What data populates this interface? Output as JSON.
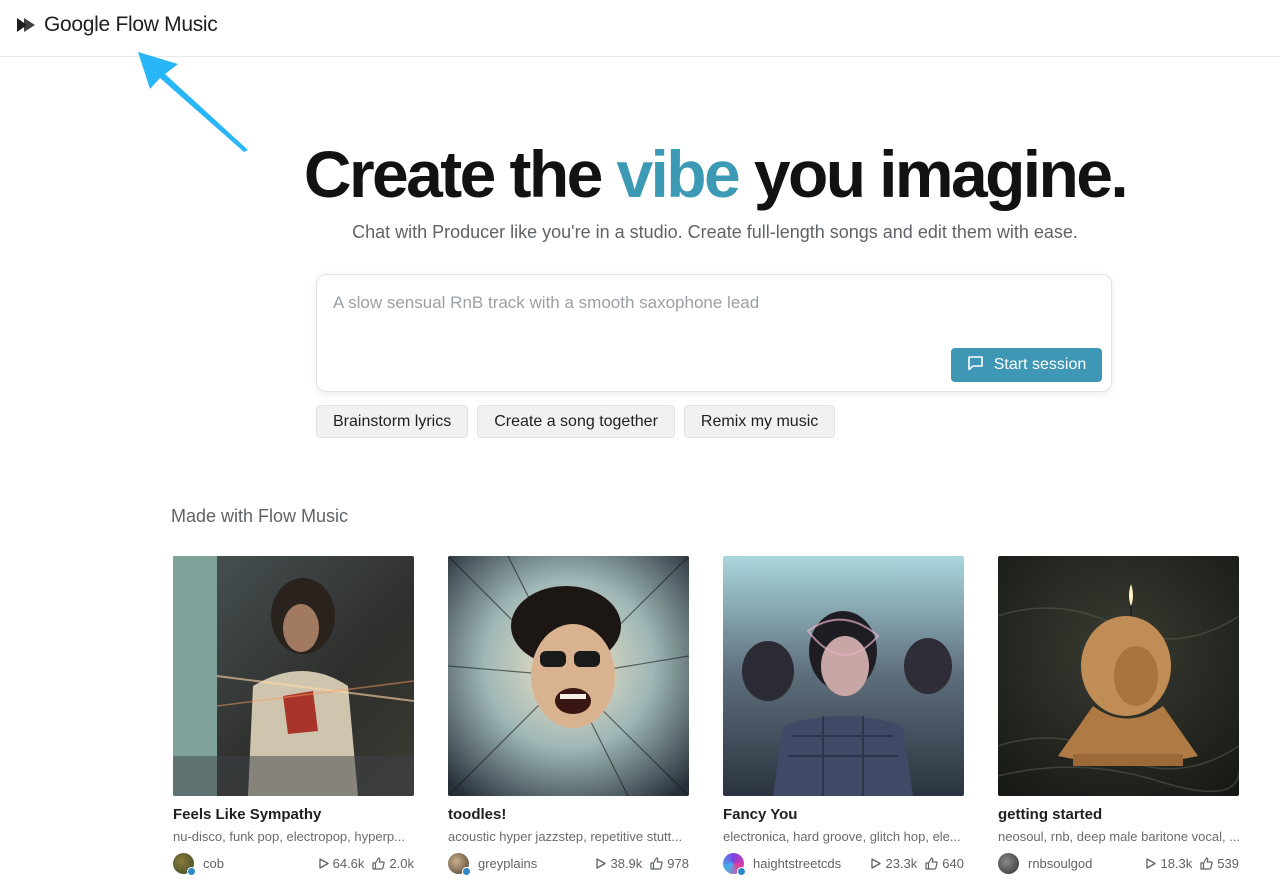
{
  "header": {
    "logo_text": "Google Flow Music"
  },
  "hero": {
    "headline_before": "Create the",
    "headline_accent": "vibe",
    "headline_after": "you imagine.",
    "subhead": "Chat with Producer like you're in a studio. Create full-length songs and edit them with ease."
  },
  "prompt": {
    "placeholder": "A slow sensual RnB track with a smooth saxophone lead",
    "start_label": "Start session"
  },
  "chips": [
    "Brainstorm lyrics",
    "Create a song together",
    "Remix my music"
  ],
  "gallery": {
    "title": "Made with Flow Music",
    "cards": [
      {
        "title": "Feels Like Sympathy",
        "tags": "nu-disco, funk pop, electropop, hyperp...",
        "user": "cob",
        "plays": "64.6k",
        "likes": "2.0k"
      },
      {
        "title": "toodles!",
        "tags": "acoustic hyper jazzstep, repetitive stutt...",
        "user": "greyplains",
        "plays": "38.9k",
        "likes": "978"
      },
      {
        "title": "Fancy You",
        "tags": "electronica, hard groove, glitch hop, ele...",
        "user": "haightstreetcds",
        "plays": "23.3k",
        "likes": "640"
      },
      {
        "title": "getting started",
        "tags": "neosoul, rnb, deep male baritone vocal, ...",
        "user": "rnbsoulgod",
        "plays": "18.3k",
        "likes": "539"
      }
    ]
  },
  "colors": {
    "accent": "#3d9ab5",
    "button": "#3e97b5",
    "annotation_arrow": "#29b6f6"
  },
  "icons": {
    "logo": "play-logo-icon",
    "start": "chat-bubble-icon",
    "plays": "play-icon",
    "likes": "thumbs-up-icon"
  }
}
